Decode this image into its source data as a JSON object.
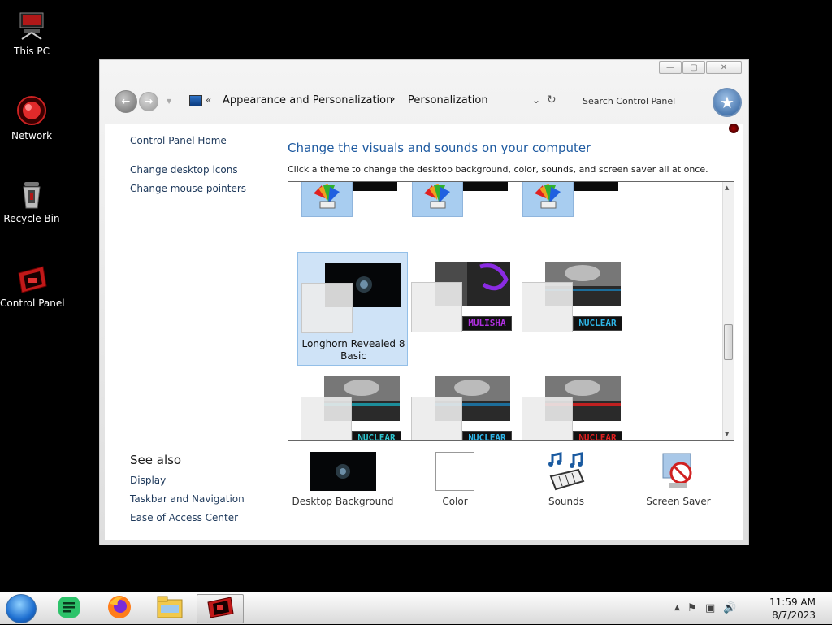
{
  "desktop": {
    "icons": [
      {
        "label": "This PC",
        "icon": "computer-icon"
      },
      {
        "label": "Network",
        "icon": "network-icon"
      },
      {
        "label": "Recycle Bin",
        "icon": "recycle-bin-icon"
      },
      {
        "label": "Control Panel",
        "icon": "control-panel-icon"
      }
    ]
  },
  "window": {
    "buttons": {
      "minimize": "—",
      "maximize": "▢",
      "close": "✕"
    },
    "navbar": {
      "back_glyph": "←",
      "forward_glyph": "→",
      "separator": "«",
      "crumbs": [
        "Appearance and Personalization",
        "Personalization"
      ],
      "chevron": "›",
      "dropdown_glyph": "⌄",
      "refresh_glyph": "↻",
      "search_placeholder": "Search Control Panel",
      "search_glyph": "★"
    },
    "sidebar": {
      "links": [
        "Control Panel Home",
        "Change desktop icons",
        "Change mouse pointers"
      ],
      "see_also_title": "See also",
      "see_also": [
        "Display",
        "Taskbar and Navigation",
        "Ease of Access Center"
      ]
    },
    "main": {
      "title": "Change the visuals and sounds on your computer",
      "description": "Click a theme to change the desktop background, color, sounds, and screen saver all at once.",
      "themes_row2": [
        {
          "name": "Longhorn Revealed 8 Basic",
          "tag": "",
          "selected": true
        },
        {
          "name": "",
          "tag": "MULISHA",
          "selected": false
        },
        {
          "name": "",
          "tag": "NUCLEAR",
          "selected": false
        }
      ],
      "themes_row3_tags": [
        "NUCLEAR",
        "NUCLEAR",
        "NUCLEAR"
      ],
      "tag_colors": {
        "mulisha": "#b030e0",
        "nuclear_blue": "#2fb6e8",
        "nuclear_red": "#e02020"
      }
    },
    "bottom": [
      {
        "label": "Desktop Background",
        "icon": "desktop-background-icon"
      },
      {
        "label": "Color",
        "icon": "color-icon"
      },
      {
        "label": "Sounds",
        "icon": "sounds-icon"
      },
      {
        "label": "Screen Saver",
        "icon": "screen-saver-icon"
      }
    ]
  },
  "taskbar": {
    "apps": [
      "start-orb",
      "notes-app-icon",
      "firefox-icon",
      "file-explorer-icon",
      "control-panel-icon"
    ],
    "tray_up": "▲",
    "tray_flag": "⚑",
    "tray_network": "▣",
    "tray_volume": "🔊",
    "time": "11:59 AM",
    "date": "8/7/2023"
  }
}
